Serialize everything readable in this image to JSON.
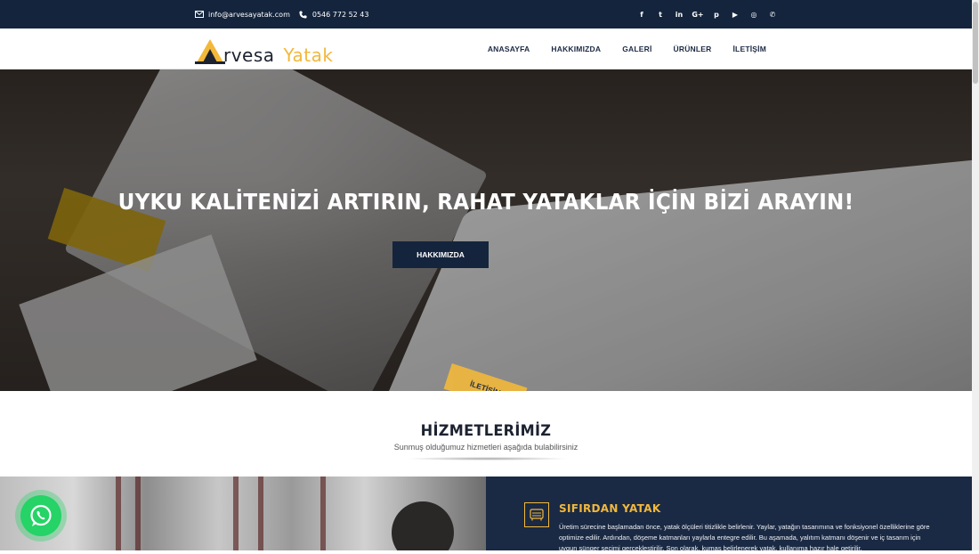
{
  "topbar": {
    "email": "info@arvesayatak.com",
    "phone": "0546 772 52 43",
    "social": [
      {
        "name": "facebook-icon",
        "glyph": "f"
      },
      {
        "name": "twitter-icon",
        "glyph": "t"
      },
      {
        "name": "linkedin-icon",
        "glyph": "in"
      },
      {
        "name": "google-plus-icon",
        "glyph": "G+"
      },
      {
        "name": "pinterest-icon",
        "glyph": "p"
      },
      {
        "name": "youtube-icon",
        "glyph": "▶"
      },
      {
        "name": "instagram-icon",
        "glyph": "◎"
      },
      {
        "name": "whatsapp-small-icon",
        "glyph": "✆"
      }
    ]
  },
  "header": {
    "logo_part1": "rvesa",
    "logo_part2": "Yatak",
    "nav": [
      "ANASAYFA",
      "HAKKIMIZDA",
      "GALERİ",
      "ÜRÜNLER",
      "İLETİŞİM"
    ]
  },
  "hero": {
    "headline": "UYKU KALİTENİZİ ARTIRIN, RAHAT YATAKLAR İÇİN BİZİ ARAYIN!",
    "btn_about": "HAKKIMIZDA",
    "btn_contact": "İLETİŞİM"
  },
  "services": {
    "title": "HİZMETLERİMİZ",
    "subtitle": "Sunmuş olduğumuz hizmetleri aşağıda bulabilirsiniz",
    "card_title": "SIFIRDAN YATAK",
    "card_text": "Üretim sürecine başlamadan önce, yatak ölçüleri titizlikle belirlenir. Yaylar, yatağın tasarımına ve fonksiyonel özelliklerine göre optimize edilir. Ardından, döşeme katmanları yaylarla entegre edilir. Bu aşamada, yalıtım katmanı döşenir ve iç tasarım için uygun sünger seçimi gerçekleştirilir. Son olarak, kumaş belirlenerek yatak, kullanıma hazır hale getirilir."
  },
  "colors": {
    "navy": "#14243d",
    "accent_yellow": "#f2b83b",
    "whatsapp_green": "#25d366"
  }
}
